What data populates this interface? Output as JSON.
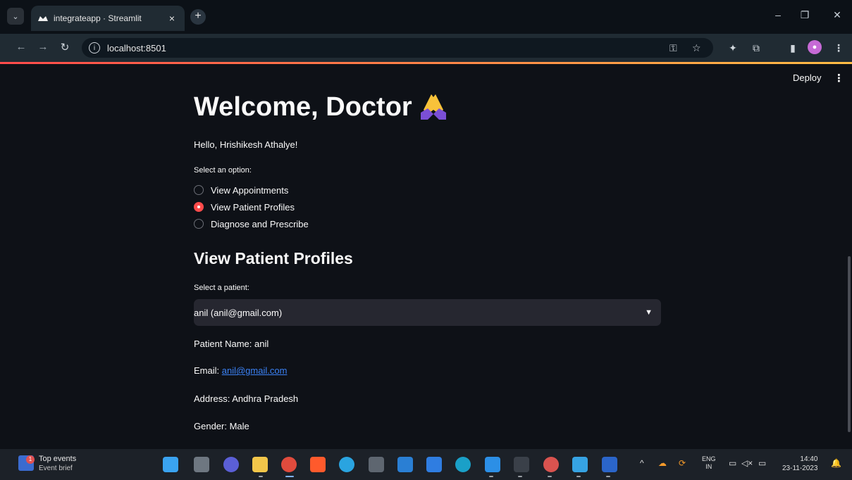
{
  "browser": {
    "tab_title": "integrateapp · Streamlit",
    "url": "localhost:8501"
  },
  "app": {
    "deploy_label": "Deploy",
    "title": "Welcome, Doctor",
    "greeting": "Hello, Hrishikesh Athalye!",
    "option_label": "Select an option:",
    "options": [
      {
        "label": "View Appointments",
        "selected": false
      },
      {
        "label": "View Patient Profiles",
        "selected": true
      },
      {
        "label": "Diagnose and Prescribe",
        "selected": false
      }
    ],
    "section_title": "View Patient Profiles",
    "patient_select_label": "Select a patient:",
    "patient_selected": "anil (anil@gmail.com)",
    "details": {
      "name_label": "Patient Name: ",
      "name_value": "anil",
      "email_label": "Email: ",
      "email_value": "anil@gmail.com",
      "address_label": "Address: ",
      "address_value": "Andhra Pradesh",
      "gender_label": "Gender: ",
      "gender_value": "Male"
    },
    "accent_color": "#ff4b4b"
  },
  "taskbar": {
    "news_title": "Top events",
    "news_subtitle": "Event brief",
    "news_badge": "1",
    "lang_line1": "ENG",
    "lang_line2": "IN",
    "time": "14:40",
    "date": "23-11-2023"
  }
}
